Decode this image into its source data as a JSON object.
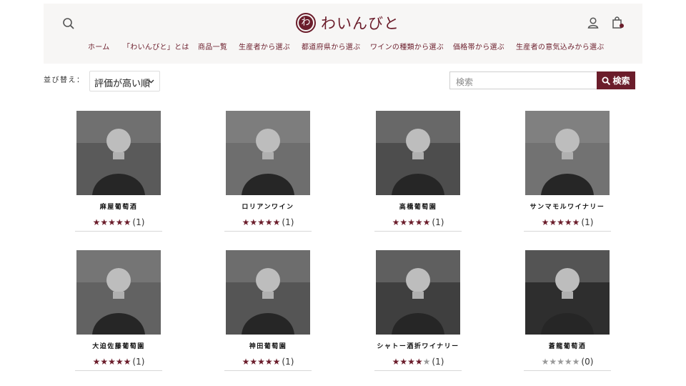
{
  "brand": {
    "logo_mark": "わ",
    "name": "わいんびと"
  },
  "header": {
    "search_icon": "search-icon",
    "account_icon": "user-icon",
    "cart_icon": "shopping-bag-icon"
  },
  "nav": [
    "ホーム",
    "「わいんびと」とは",
    "商品一覧",
    "生産者から選ぶ",
    "都道府県から選ぶ",
    "ワインの種類から選ぶ",
    "価格帯から選ぶ",
    "生産者の意気込みから選ぶ"
  ],
  "sort": {
    "label": "並び替え：",
    "selected": "評価が高い順"
  },
  "search": {
    "placeholder": "検索",
    "button_label": "検索"
  },
  "colors": {
    "accent": "#6b1d2b",
    "header_bg": "#f7f6f5",
    "star_off": "#9a9a9a"
  },
  "producers": [
    {
      "name": "麻屋葡萄酒",
      "rating": 5,
      "count": "(1)"
    },
    {
      "name": "ロリアンワイン",
      "rating": 5,
      "count": "(1)"
    },
    {
      "name": "高橋葡萄園",
      "rating": 5,
      "count": "(1)"
    },
    {
      "name": "サンマモルワイナリー",
      "rating": 5,
      "count": "(1)"
    },
    {
      "name": "大迫佐藤葡萄園",
      "rating": 5,
      "count": "(1)"
    },
    {
      "name": "神田葡萄園",
      "rating": 5,
      "count": "(1)"
    },
    {
      "name": "シャトー酒折ワイナリー",
      "rating": 4,
      "count": "(1)"
    },
    {
      "name": "蒼龍葡萄酒",
      "rating": 0,
      "count": "(0)"
    }
  ]
}
